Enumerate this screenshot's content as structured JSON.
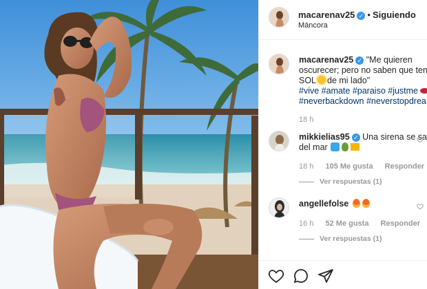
{
  "post": {
    "username": "macarenav25",
    "follow_state": "Siguiendo",
    "separator": "•",
    "location": "Máncora"
  },
  "caption": {
    "username": "macarenav25",
    "line1": "\"Me quieren",
    "line2": "oscurecer; pero no saben que teng",
    "line3a": "SOL",
    "line3b": "de mi lado\"",
    "hashtags_line1": "#vive #amate #paraiso #justme",
    "hashtags_line2": "#neverbackdown #neverstopdrea",
    "time": "18 h"
  },
  "comments": [
    {
      "username": "mikkielias95",
      "text_line1": "Una sirena se salió",
      "text_line2": "del mar",
      "time": "18 h",
      "likes": "105 Me gusta",
      "reply": "Responder",
      "view_replies": "Ver respuestas (1)"
    },
    {
      "username": "angellefolse",
      "time": "16 h",
      "likes": "52 Me gusta",
      "reply": "Responder",
      "view_replies": "Ver respuestas (1)"
    }
  ],
  "actions": {
    "like_icon": "heart-outline-icon",
    "comment_icon": "speech-bubble-icon",
    "share_icon": "paper-plane-icon"
  },
  "colors": {
    "verified": "#3897f0",
    "hashtag": "#003569",
    "meta": "#999999",
    "border": "#efefef"
  }
}
